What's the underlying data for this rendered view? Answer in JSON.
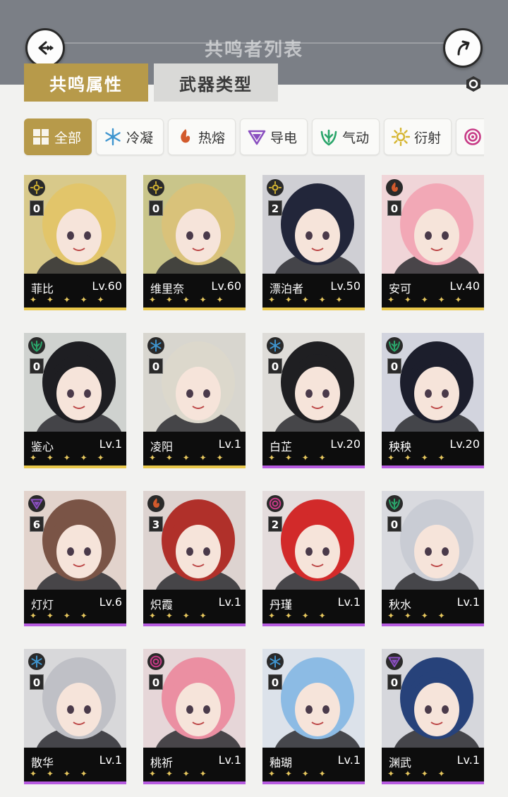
{
  "header": {
    "title": "共鸣者列表"
  },
  "tabs": [
    {
      "label": "共鸣属性"
    },
    {
      "label": "武器类型"
    }
  ],
  "filters": [
    {
      "label": "全部",
      "icon": "grid-icon"
    },
    {
      "label": "冷凝",
      "icon": "glacio-icon",
      "color": "#3f95cf"
    },
    {
      "label": "热熔",
      "icon": "fusion-icon",
      "color": "#d25a2c"
    },
    {
      "label": "导电",
      "icon": "electro-icon",
      "color": "#8a4fc0"
    },
    {
      "label": "气动",
      "icon": "aero-icon",
      "color": "#2aa56a"
    },
    {
      "label": "衍射",
      "icon": "spectro-icon",
      "color": "#d6b632"
    },
    {
      "label": "湮灭",
      "icon": "havoc-icon",
      "color": "#c73a86"
    }
  ],
  "characters": [
    {
      "name": "菲比",
      "level": "Lv.60",
      "chain": "0",
      "element": "spectro",
      "rarity": 5,
      "stars": "✦ ✦ ✦ ✦ ✦",
      "bg": "#d8c98a",
      "hair": "#e2c56a"
    },
    {
      "name": "维里奈",
      "level": "Lv.60",
      "chain": "0",
      "element": "spectro",
      "rarity": 5,
      "stars": "✦ ✦ ✦ ✦ ✦",
      "bg": "#c9c58a",
      "hair": "#d9c27a"
    },
    {
      "name": "漂泊者",
      "level": "Lv.50",
      "chain": "2",
      "element": "spectro",
      "rarity": 5,
      "stars": "✦ ✦ ✦ ✦ ✦",
      "bg": "#cfcfd4",
      "hair": "#22263a"
    },
    {
      "name": "安可",
      "level": "Lv.40",
      "chain": "0",
      "element": "fusion",
      "rarity": 5,
      "stars": "✦ ✦ ✦ ✦ ✦",
      "bg": "#f0d5d8",
      "hair": "#f2a8b6"
    },
    {
      "name": "鉴心",
      "level": "Lv.1",
      "chain": "0",
      "element": "aero",
      "rarity": 5,
      "stars": "✦ ✦ ✦ ✦ ✦",
      "bg": "#cfd2cf",
      "hair": "#1e1e22"
    },
    {
      "name": "凌阳",
      "level": "Lv.1",
      "chain": "0",
      "element": "glacio",
      "rarity": 5,
      "stars": "✦ ✦ ✦ ✦ ✦",
      "bg": "#d8d6cf",
      "hair": "#dcd8cc"
    },
    {
      "name": "白芷",
      "level": "Lv.20",
      "chain": "0",
      "element": "glacio",
      "rarity": 4,
      "stars": "✦ ✦ ✦ ✦",
      "bg": "#dedcd8",
      "hair": "#1f1f22"
    },
    {
      "name": "秧秧",
      "level": "Lv.20",
      "chain": "0",
      "element": "aero",
      "rarity": 4,
      "stars": "✦ ✦ ✦ ✦",
      "bg": "#d2d4de",
      "hair": "#1c1e2c"
    },
    {
      "name": "灯灯",
      "level": "Lv.6",
      "chain": "6",
      "element": "electro",
      "rarity": 4,
      "stars": "✦ ✦ ✦ ✦",
      "bg": "#e2d3cc",
      "hair": "#7a5446"
    },
    {
      "name": "炽霞",
      "level": "Lv.1",
      "chain": "3",
      "element": "fusion",
      "rarity": 4,
      "stars": "✦ ✦ ✦ ✦",
      "bg": "#ddd3d0",
      "hair": "#b0302a"
    },
    {
      "name": "丹瑾",
      "level": "Lv.1",
      "chain": "2",
      "element": "havoc",
      "rarity": 4,
      "stars": "✦ ✦ ✦ ✦",
      "bg": "#e4dcdc",
      "hair": "#d22a2a"
    },
    {
      "name": "秋水",
      "level": "Lv.1",
      "chain": "0",
      "element": "aero",
      "rarity": 4,
      "stars": "✦ ✦ ✦ ✦",
      "bg": "#d9dadf",
      "hair": "#c9ccd4"
    },
    {
      "name": "散华",
      "level": "Lv.1",
      "chain": "0",
      "element": "glacio",
      "rarity": 4,
      "stars": "✦ ✦ ✦ ✦",
      "bg": "#d8d8da",
      "hair": "#bfc0c6"
    },
    {
      "name": "桃祈",
      "level": "Lv.1",
      "chain": "0",
      "element": "havoc",
      "rarity": 4,
      "stars": "✦ ✦ ✦ ✦",
      "bg": "#e6d6d8",
      "hair": "#eb8fa2"
    },
    {
      "name": "釉瑚",
      "level": "Lv.1",
      "chain": "0",
      "element": "glacio",
      "rarity": 4,
      "stars": "✦ ✦ ✦ ✦",
      "bg": "#dce2ea",
      "hair": "#8cbbe4"
    },
    {
      "name": "渊武",
      "level": "Lv.1",
      "chain": "0",
      "element": "electro",
      "rarity": 4,
      "stars": "✦ ✦ ✦ ✦",
      "bg": "#d6d7dc",
      "hair": "#27427a"
    }
  ],
  "colors": {
    "accent": "#b79a4a",
    "rarity5": "#e9c84a",
    "rarity4": "#b75be0",
    "spectro": "#d6b632",
    "fusion": "#d25a2c",
    "aero": "#2aa56a",
    "glacio": "#3f95cf",
    "electro": "#8a4fc0",
    "havoc": "#c73a86"
  }
}
